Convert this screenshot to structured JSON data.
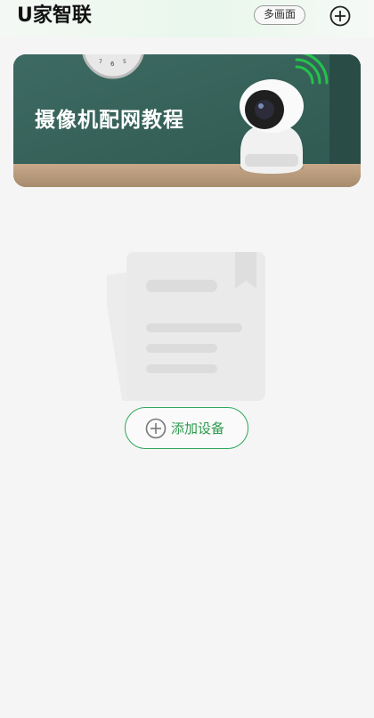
{
  "header": {
    "title": "U家智联",
    "multi_view_label": "多画面",
    "add_icon": "plus-circle-icon"
  },
  "banner": {
    "text": "摄像机配网教程"
  },
  "empty_state": {
    "illustration": "document-icon",
    "add_device_label": "添加设备",
    "add_device_icon": "plus-circle-icon"
  },
  "colors": {
    "accent_green": "#2c9a4c",
    "background": "#f5f5f5"
  }
}
